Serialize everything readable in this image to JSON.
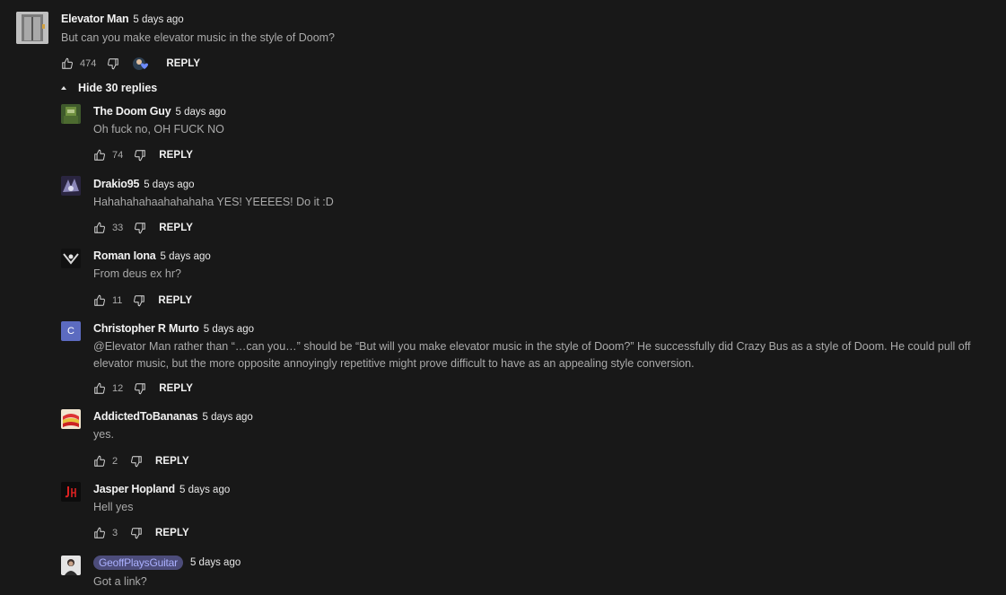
{
  "top": {
    "author": "Elevator Man",
    "time": "5 days ago",
    "text": "But can you make elevator music in the style of Doom?",
    "likes": "474",
    "reply_label": "REPLY"
  },
  "toggle": {
    "label": "Hide 30 replies"
  },
  "replies": [
    {
      "author": "The Doom Guy",
      "time": "5 days ago",
      "text": "Oh fuck no, OH FUCK NO",
      "likes": "74",
      "reply_label": "REPLY"
    },
    {
      "author": "Drakio95",
      "time": "5 days ago",
      "text": "Hahahahahaahahahaha YES! YEEEES! Do it :D",
      "likes": "33",
      "reply_label": "REPLY"
    },
    {
      "author": "Roman Iona",
      "time": "5 days ago",
      "text": "From deus ex hr?",
      "likes": "11",
      "reply_label": "REPLY"
    },
    {
      "author": "Christopher R Murto",
      "time": "5 days ago",
      "avatar_letter": "C",
      "text_line1": "@Elevator Man rather than “…can you…” should be “But will you make elevator music in the style of Doom?” He successfully did Crazy Bus as a style of Doom. He could pull off",
      "text_line2": "elevator music, but the more opposite annoyingly repetitive might prove difficult to have as an appealing style conversion.",
      "likes": "12",
      "reply_label": "REPLY"
    },
    {
      "author": "AddictedToBananas",
      "time": "5 days ago",
      "text": "yes.",
      "likes": "2",
      "reply_label": "REPLY"
    },
    {
      "author": "Jasper Hopland",
      "time": "5 days ago",
      "text": "Hell yes",
      "likes": "3",
      "reply_label": "REPLY"
    },
    {
      "author": "GeoffPlaysGuitar",
      "time": "5 days ago",
      "text": "Got a link?"
    }
  ],
  "colors": {
    "background": "#181818",
    "owner_badge_bg": "#4c4c7a",
    "owner_badge_fg": "#aab0ff"
  },
  "icons": {
    "like": "thumb-up-icon",
    "dislike": "thumb-down-icon",
    "hearted": "creator-heart-icon"
  }
}
